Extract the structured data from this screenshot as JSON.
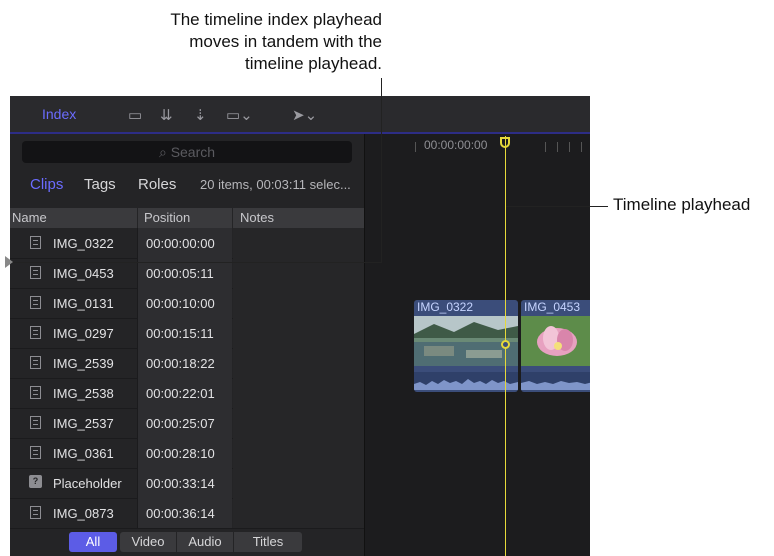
{
  "callouts": {
    "top_line1": "The timeline index playhead",
    "top_line2": "moves in tandem with the",
    "top_line3": "timeline playhead.",
    "right": "Timeline playhead"
  },
  "toolbar": {
    "index_label": "Index"
  },
  "index": {
    "search_placeholder": "Search",
    "tabs": {
      "clips": "Clips",
      "tags": "Tags",
      "roles": "Roles"
    },
    "selection_info": "20 items, 00:03:11 selec...",
    "columns": {
      "name": "Name",
      "position": "Position",
      "notes": "Notes"
    },
    "rows": [
      {
        "name": "IMG_0322",
        "position": "00:00:00:00",
        "icon": "film-icon"
      },
      {
        "name": "IMG_0453",
        "position": "00:00:05:11",
        "icon": "film-icon"
      },
      {
        "name": "IMG_0131",
        "position": "00:00:10:00",
        "icon": "film-icon"
      },
      {
        "name": "IMG_0297",
        "position": "00:00:15:11",
        "icon": "film-icon"
      },
      {
        "name": "IMG_2539",
        "position": "00:00:18:22",
        "icon": "film-icon"
      },
      {
        "name": "IMG_2538",
        "position": "00:00:22:01",
        "icon": "film-icon"
      },
      {
        "name": "IMG_2537",
        "position": "00:00:25:07",
        "icon": "film-icon"
      },
      {
        "name": "IMG_0361",
        "position": "00:00:28:10",
        "icon": "film-icon"
      },
      {
        "name": "Placeholder",
        "position": "00:00:33:14",
        "icon": "placeholder-icon"
      },
      {
        "name": "IMG_0873",
        "position": "00:00:36:14",
        "icon": "film-icon"
      }
    ],
    "bottom_tabs": {
      "all": "All",
      "video": "Video",
      "audio": "Audio",
      "titles": "Titles"
    }
  },
  "timeline": {
    "timecode": "00:00:00:00",
    "clips": [
      {
        "name": "IMG_0322"
      },
      {
        "name": "IMG_0453"
      }
    ]
  },
  "colors": {
    "accent": "#6b6cff",
    "playhead": "#e6d93a",
    "clip": "#3b4d7a"
  }
}
